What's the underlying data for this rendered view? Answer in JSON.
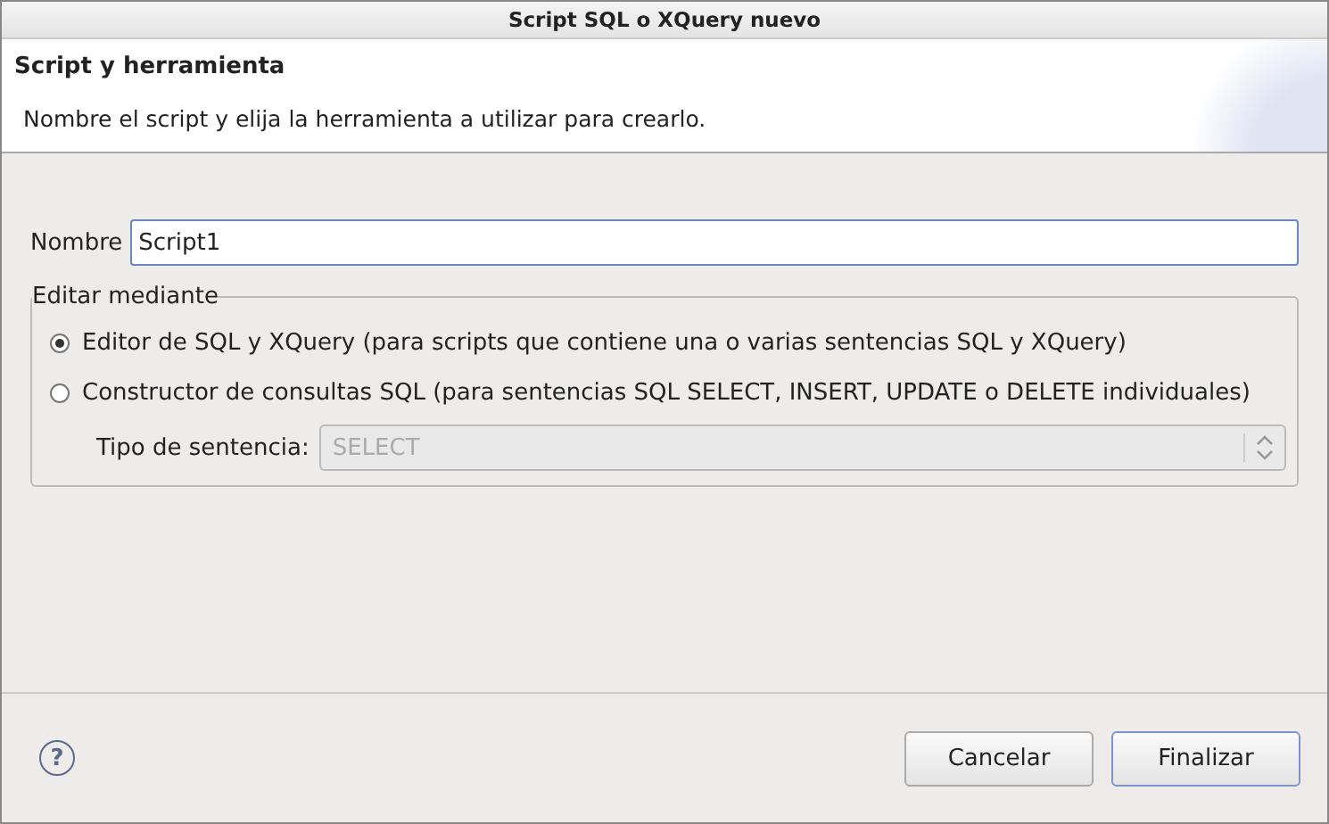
{
  "window": {
    "title": "Script SQL o XQuery nuevo"
  },
  "header": {
    "title": "Script y herramienta",
    "description": "Nombre el script y elija la herramienta a utilizar para crearlo."
  },
  "name_field": {
    "label": "Nombre",
    "value": "Script1"
  },
  "edit_group": {
    "legend": "Editar mediante",
    "options": [
      {
        "label": "Editor de SQL y XQuery (para scripts que contiene una o varias sentencias SQL y XQuery)",
        "selected": true
      },
      {
        "label": "Constructor de consultas SQL (para sentencias SQL SELECT, INSERT, UPDATE o DELETE individuales)",
        "selected": false
      }
    ],
    "statement_type": {
      "label": "Tipo de sentencia:",
      "value": "SELECT",
      "disabled": true
    }
  },
  "help": {
    "label": "?"
  },
  "buttons": [
    {
      "label": "Cancelar",
      "default": false
    },
    {
      "label": "Finalizar",
      "default": true
    }
  ]
}
